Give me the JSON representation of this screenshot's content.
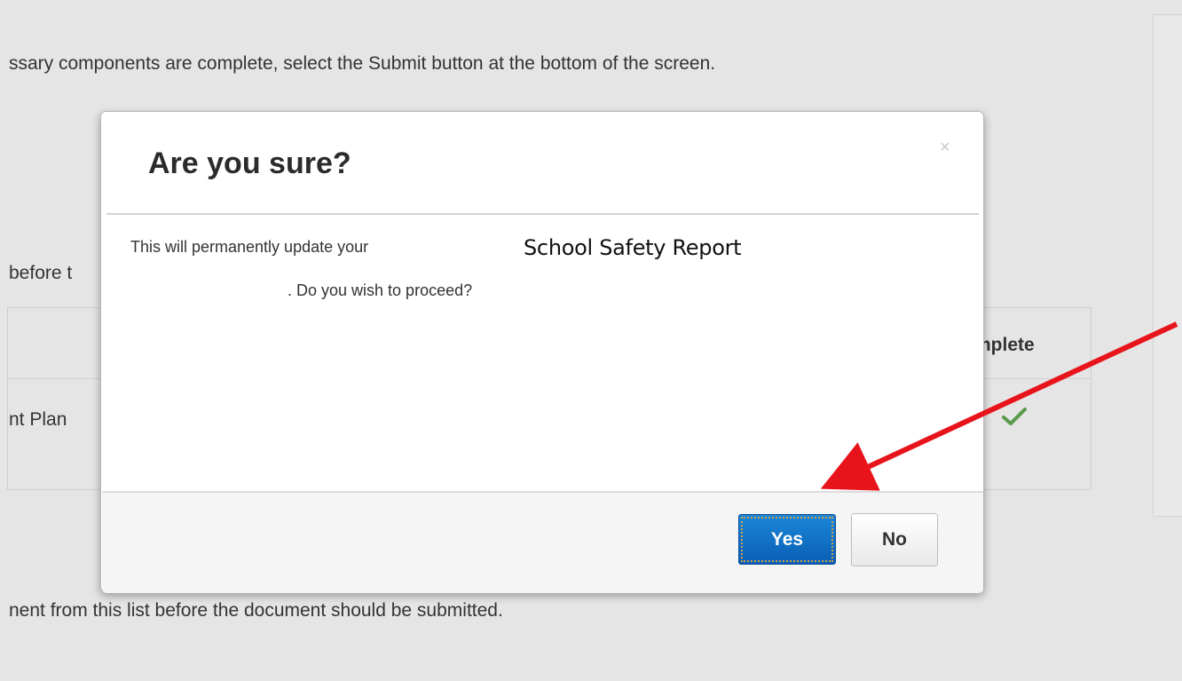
{
  "background": {
    "instruction_text": "ssary components are complete, select the Submit button at the bottom of the screen.",
    "partial_text": "before t",
    "table_header_complete": "mplete",
    "table_row_component": "nt Plan",
    "check_icon": "check-icon",
    "footer_text": "nent from this list before the document should be submitted."
  },
  "modal": {
    "title": "Are you sure?",
    "close_glyph": "×",
    "body_line_1": "This will permanently update your",
    "report_name": "School Safety Report",
    "body_line_2": ". Do you wish to proceed?",
    "yes_label": "Yes",
    "no_label": "No"
  },
  "colors": {
    "primary_button": "#0a6cc4",
    "annotation_arrow": "#e8141c",
    "check": "#5a9a4c"
  }
}
